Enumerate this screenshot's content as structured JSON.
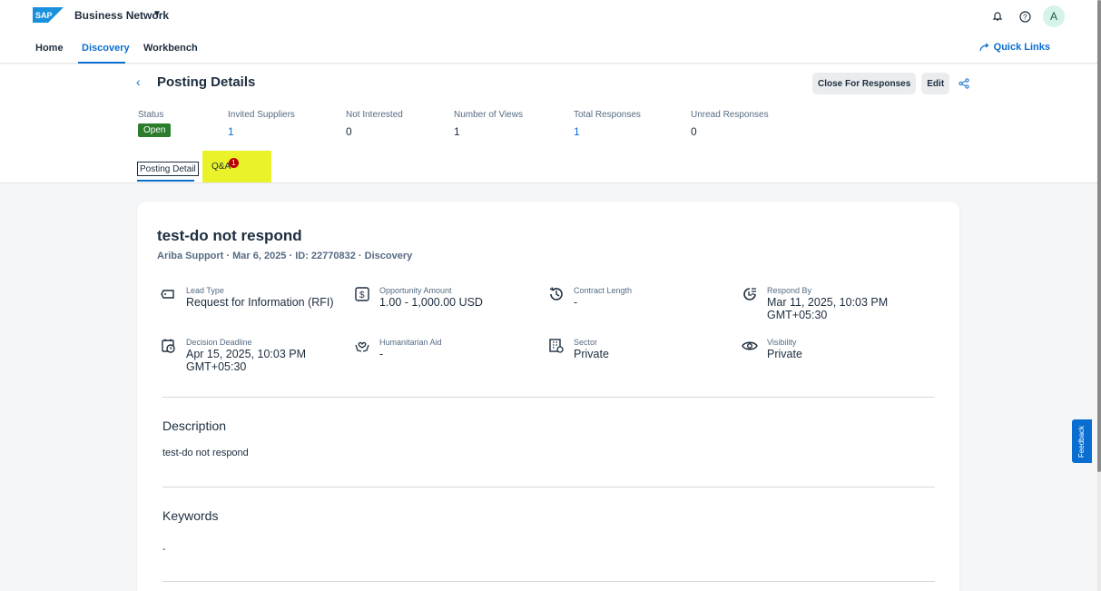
{
  "shell": {
    "logo_text": "SAP",
    "product": "Business Network",
    "avatar_initial": "A"
  },
  "nav": {
    "home": "Home",
    "discovery": "Discovery",
    "workbench": "Workbench",
    "quick_links": "Quick Links"
  },
  "header": {
    "title": "Posting Details",
    "close_button": "Close For Responses",
    "edit_button": "Edit"
  },
  "stats": {
    "status_label": "Status",
    "status_value": "Open",
    "invited_label": "Invited Suppliers",
    "invited_value": "1",
    "not_interested_label": "Not Interested",
    "not_interested_value": "0",
    "views_label": "Number of Views",
    "views_value": "1",
    "total_label": "Total Responses",
    "total_value": "1",
    "unread_label": "Unread Responses",
    "unread_value": "0"
  },
  "tabs": {
    "detail": "Posting Detail",
    "qa": "Q&A",
    "qa_badge": "1"
  },
  "posting": {
    "title": "test-do not respond",
    "meta": "Ariba Support · Mar 6, 2025 · ID: 22770832 · Discovery",
    "attributes": {
      "lead_type": {
        "label": "Lead Type",
        "value": "Request for Information (RFI)"
      },
      "opportunity_amount": {
        "label": "Opportunity Amount",
        "value": "1.00 - 1,000.00 USD"
      },
      "contract_length": {
        "label": "Contract Length",
        "value": "-"
      },
      "respond_by": {
        "label": "Respond By",
        "value": "Mar 11, 2025, 10:03 PM GMT+05:30"
      },
      "decision_deadline": {
        "label": "Decision Deadline",
        "value": "Apr 15, 2025, 10:03 PM GMT+05:30"
      },
      "humanitarian_aid": {
        "label": "Humanitarian Aid",
        "value": "-"
      },
      "sector": {
        "label": "Sector",
        "value": "Private"
      },
      "visibility": {
        "label": "Visibility",
        "value": "Private"
      }
    },
    "description_title": "Description",
    "description_text": "test-do not respond",
    "keywords_title": "Keywords",
    "keywords_text": "-"
  },
  "feedback": "Feedback",
  "colors": {
    "accent": "#0a6ed1",
    "status_open": "#2b7d2b",
    "highlight": "#eaf22a",
    "badge": "#bb0000"
  }
}
